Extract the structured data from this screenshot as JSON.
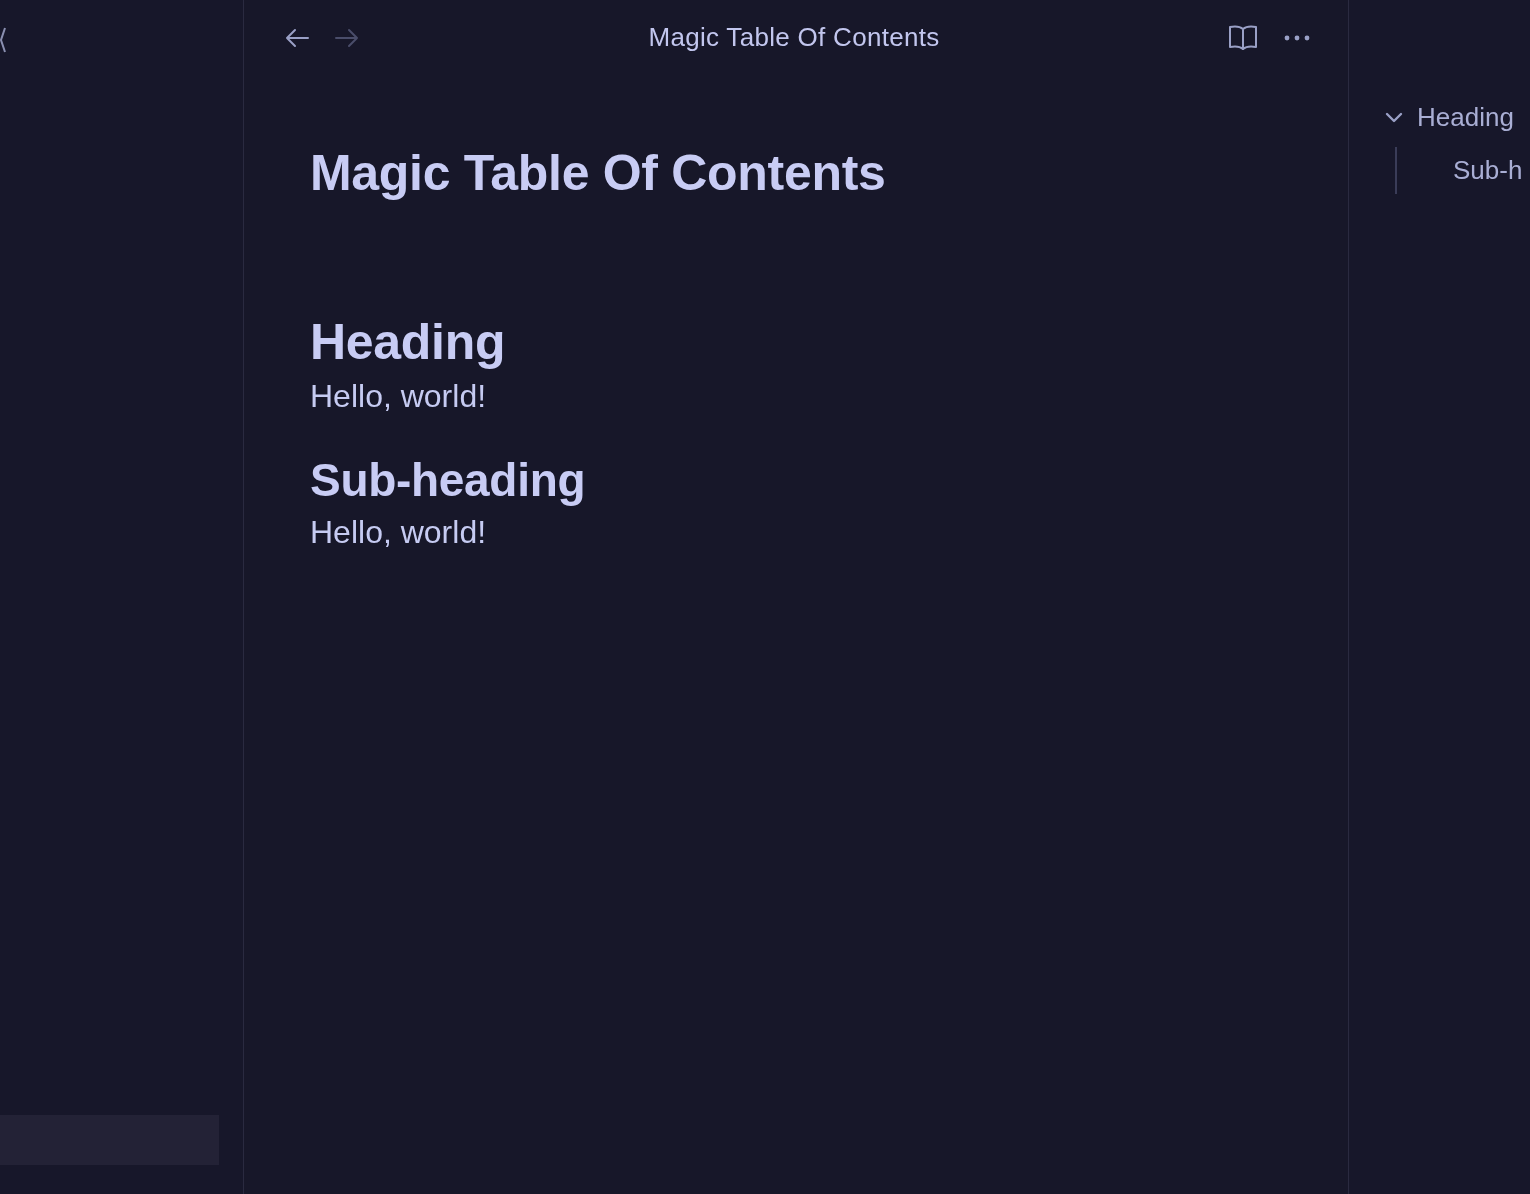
{
  "navigation": {
    "back": {
      "disabled": false
    },
    "forward": {
      "disabled": true
    }
  },
  "tab_title": "Magic Table Of Contents",
  "document": {
    "title": "Magic Table Of Contents",
    "sections": [
      {
        "kind": "heading",
        "heading": "Heading",
        "text": "Hello, world!"
      },
      {
        "kind": "subheading",
        "heading": "Sub-heading",
        "text": "Hello, world!"
      }
    ]
  },
  "outline": {
    "items": [
      {
        "label": "Heading",
        "expanded": true,
        "children": [
          {
            "label": "Sub-h"
          }
        ]
      }
    ]
  }
}
